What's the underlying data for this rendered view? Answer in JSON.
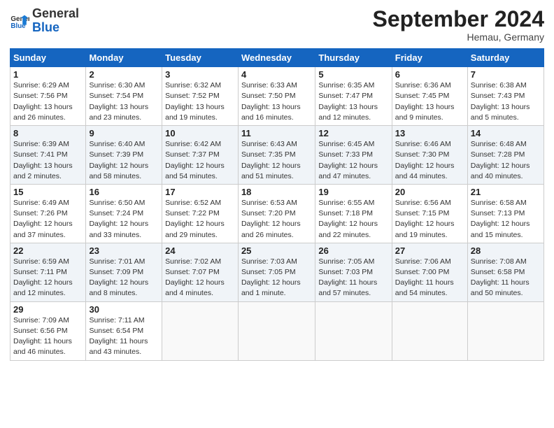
{
  "header": {
    "logo_line1": "General",
    "logo_line2": "Blue",
    "month": "September 2024",
    "location": "Hemau, Germany"
  },
  "weekdays": [
    "Sunday",
    "Monday",
    "Tuesday",
    "Wednesday",
    "Thursday",
    "Friday",
    "Saturday"
  ],
  "weeks": [
    [
      {
        "day": "1",
        "info": "Sunrise: 6:29 AM\nSunset: 7:56 PM\nDaylight: 13 hours\nand 26 minutes."
      },
      {
        "day": "2",
        "info": "Sunrise: 6:30 AM\nSunset: 7:54 PM\nDaylight: 13 hours\nand 23 minutes."
      },
      {
        "day": "3",
        "info": "Sunrise: 6:32 AM\nSunset: 7:52 PM\nDaylight: 13 hours\nand 19 minutes."
      },
      {
        "day": "4",
        "info": "Sunrise: 6:33 AM\nSunset: 7:50 PM\nDaylight: 13 hours\nand 16 minutes."
      },
      {
        "day": "5",
        "info": "Sunrise: 6:35 AM\nSunset: 7:47 PM\nDaylight: 13 hours\nand 12 minutes."
      },
      {
        "day": "6",
        "info": "Sunrise: 6:36 AM\nSunset: 7:45 PM\nDaylight: 13 hours\nand 9 minutes."
      },
      {
        "day": "7",
        "info": "Sunrise: 6:38 AM\nSunset: 7:43 PM\nDaylight: 13 hours\nand 5 minutes."
      }
    ],
    [
      {
        "day": "8",
        "info": "Sunrise: 6:39 AM\nSunset: 7:41 PM\nDaylight: 13 hours\nand 2 minutes."
      },
      {
        "day": "9",
        "info": "Sunrise: 6:40 AM\nSunset: 7:39 PM\nDaylight: 12 hours\nand 58 minutes."
      },
      {
        "day": "10",
        "info": "Sunrise: 6:42 AM\nSunset: 7:37 PM\nDaylight: 12 hours\nand 54 minutes."
      },
      {
        "day": "11",
        "info": "Sunrise: 6:43 AM\nSunset: 7:35 PM\nDaylight: 12 hours\nand 51 minutes."
      },
      {
        "day": "12",
        "info": "Sunrise: 6:45 AM\nSunset: 7:33 PM\nDaylight: 12 hours\nand 47 minutes."
      },
      {
        "day": "13",
        "info": "Sunrise: 6:46 AM\nSunset: 7:30 PM\nDaylight: 12 hours\nand 44 minutes."
      },
      {
        "day": "14",
        "info": "Sunrise: 6:48 AM\nSunset: 7:28 PM\nDaylight: 12 hours\nand 40 minutes."
      }
    ],
    [
      {
        "day": "15",
        "info": "Sunrise: 6:49 AM\nSunset: 7:26 PM\nDaylight: 12 hours\nand 37 minutes."
      },
      {
        "day": "16",
        "info": "Sunrise: 6:50 AM\nSunset: 7:24 PM\nDaylight: 12 hours\nand 33 minutes."
      },
      {
        "day": "17",
        "info": "Sunrise: 6:52 AM\nSunset: 7:22 PM\nDaylight: 12 hours\nand 29 minutes."
      },
      {
        "day": "18",
        "info": "Sunrise: 6:53 AM\nSunset: 7:20 PM\nDaylight: 12 hours\nand 26 minutes."
      },
      {
        "day": "19",
        "info": "Sunrise: 6:55 AM\nSunset: 7:18 PM\nDaylight: 12 hours\nand 22 minutes."
      },
      {
        "day": "20",
        "info": "Sunrise: 6:56 AM\nSunset: 7:15 PM\nDaylight: 12 hours\nand 19 minutes."
      },
      {
        "day": "21",
        "info": "Sunrise: 6:58 AM\nSunset: 7:13 PM\nDaylight: 12 hours\nand 15 minutes."
      }
    ],
    [
      {
        "day": "22",
        "info": "Sunrise: 6:59 AM\nSunset: 7:11 PM\nDaylight: 12 hours\nand 12 minutes."
      },
      {
        "day": "23",
        "info": "Sunrise: 7:01 AM\nSunset: 7:09 PM\nDaylight: 12 hours\nand 8 minutes."
      },
      {
        "day": "24",
        "info": "Sunrise: 7:02 AM\nSunset: 7:07 PM\nDaylight: 12 hours\nand 4 minutes."
      },
      {
        "day": "25",
        "info": "Sunrise: 7:03 AM\nSunset: 7:05 PM\nDaylight: 12 hours\nand 1 minute."
      },
      {
        "day": "26",
        "info": "Sunrise: 7:05 AM\nSunset: 7:03 PM\nDaylight: 11 hours\nand 57 minutes."
      },
      {
        "day": "27",
        "info": "Sunrise: 7:06 AM\nSunset: 7:00 PM\nDaylight: 11 hours\nand 54 minutes."
      },
      {
        "day": "28",
        "info": "Sunrise: 7:08 AM\nSunset: 6:58 PM\nDaylight: 11 hours\nand 50 minutes."
      }
    ],
    [
      {
        "day": "29",
        "info": "Sunrise: 7:09 AM\nSunset: 6:56 PM\nDaylight: 11 hours\nand 46 minutes."
      },
      {
        "day": "30",
        "info": "Sunrise: 7:11 AM\nSunset: 6:54 PM\nDaylight: 11 hours\nand 43 minutes."
      },
      {
        "day": "",
        "info": ""
      },
      {
        "day": "",
        "info": ""
      },
      {
        "day": "",
        "info": ""
      },
      {
        "day": "",
        "info": ""
      },
      {
        "day": "",
        "info": ""
      }
    ]
  ]
}
